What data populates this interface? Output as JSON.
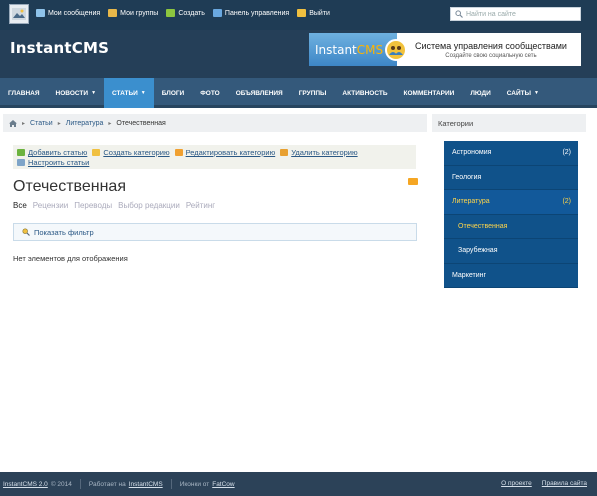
{
  "topbar": {
    "items": [
      {
        "label": "Мои сообщения",
        "icon": "mail-icon",
        "color": "#8fc3ea"
      },
      {
        "label": "Мои группы",
        "icon": "users-icon",
        "color": "#e8b84a"
      },
      {
        "label": "Создать",
        "icon": "plus-icon",
        "color": "#8cc63f"
      },
      {
        "label": "Панель управления",
        "icon": "dashboard-icon",
        "color": "#6aa8e0"
      },
      {
        "label": "Выйти",
        "icon": "logout-icon",
        "color": "#f0c040"
      }
    ],
    "search_placeholder": "Найти на сайте"
  },
  "header": {
    "logo": "InstantCMS",
    "banner": {
      "logo_main": "Instant",
      "logo_accent": "CMS",
      "title": "Система управления сообществами",
      "subtitle": "Создайте свою социальную сеть"
    }
  },
  "mainmenu": [
    {
      "label": "ГЛАВНАЯ",
      "dropdown": false,
      "active": false
    },
    {
      "label": "НОВОСТИ",
      "dropdown": true,
      "active": false
    },
    {
      "label": "СТАТЬИ",
      "dropdown": true,
      "active": true
    },
    {
      "label": "БЛОГИ",
      "dropdown": false,
      "active": false
    },
    {
      "label": "ФОТО",
      "dropdown": false,
      "active": false
    },
    {
      "label": "ОБЪЯВЛЕНИЯ",
      "dropdown": false,
      "active": false
    },
    {
      "label": "ГРУППЫ",
      "dropdown": false,
      "active": false
    },
    {
      "label": "АКТИВНОСТЬ",
      "dropdown": false,
      "active": false
    },
    {
      "label": "КОММЕНТАРИИ",
      "dropdown": false,
      "active": false
    },
    {
      "label": "ЛЮДИ",
      "dropdown": false,
      "active": false
    },
    {
      "label": "САЙТЫ",
      "dropdown": true,
      "active": false
    }
  ],
  "breadcrumb": {
    "items": [
      "Статьи",
      "Литература"
    ],
    "current": "Отечественная"
  },
  "actions": [
    {
      "label": "Добавить статью",
      "icon": "add-icon",
      "color": "#6cb33f"
    },
    {
      "label": "Создать категорию",
      "icon": "folder-add-icon",
      "color": "#f0c040"
    },
    {
      "label": "Редактировать категорию",
      "icon": "folder-edit-icon",
      "color": "#f0a030"
    },
    {
      "label": "Удалить категорию",
      "icon": "folder-delete-icon",
      "color": "#e8a030"
    },
    {
      "label": "Настроить статьи",
      "icon": "settings-icon",
      "color": "#7ea4c8"
    }
  ],
  "page": {
    "title": "Отечественная",
    "tabs": [
      "Все",
      "Рецензии",
      "Переводы",
      "Выбор редакции",
      "Рейтинг"
    ],
    "filter_label": "Показать фильтр",
    "empty_text": "Нет элементов для отображения"
  },
  "sidebar": {
    "title": "Категории",
    "categories": [
      {
        "label": "Астрономия",
        "count": "(2)",
        "level": 0,
        "state": ""
      },
      {
        "label": "Геология",
        "count": "",
        "level": 0,
        "state": ""
      },
      {
        "label": "Литература",
        "count": "(2)",
        "level": 0,
        "state": "active"
      },
      {
        "label": "Отечественная",
        "count": "",
        "level": 1,
        "state": "subactive"
      },
      {
        "label": "Зарубежная",
        "count": "",
        "level": 1,
        "state": ""
      },
      {
        "label": "Маркетинг",
        "count": "",
        "level": 0,
        "state": ""
      }
    ]
  },
  "footer": {
    "version_link": "InstantCMS 2.0",
    "year": "© 2014",
    "powered_prefix": "Работает на",
    "powered_link": "InstantCMS",
    "icons_prefix": "Иконки от",
    "icons_link": "FatCow",
    "about": "О проекте",
    "rules": "Правила сайта"
  },
  "colors": {
    "accent": "#3b8fce",
    "sidebar_bg": "#10528a",
    "active_text": "#ffd54a"
  }
}
